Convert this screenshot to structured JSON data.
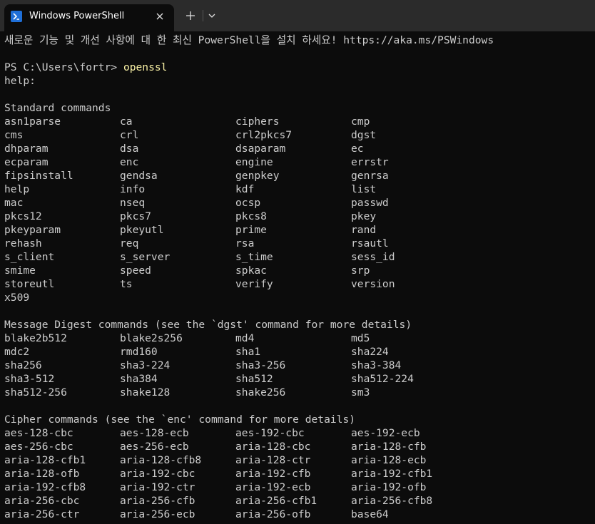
{
  "tab": {
    "title": "Windows PowerShell",
    "close_icon": "close-icon",
    "new_tab_icon": "plus-icon",
    "dropdown_icon": "chevron-down-icon"
  },
  "terminal": {
    "banner": "새로운 기능 및 개선 사항에 대 한 최신 PowerShell을 설치 하세요! https://aka.ms/PSWindows",
    "prompt": "PS C:\\Users\\fortr> ",
    "command": "openssl",
    "help_line": "help:",
    "standard_header": "Standard commands",
    "standard_commands": [
      [
        "asn1parse",
        "ca",
        "ciphers",
        "cmp"
      ],
      [
        "cms",
        "crl",
        "crl2pkcs7",
        "dgst"
      ],
      [
        "dhparam",
        "dsa",
        "dsaparam",
        "ec"
      ],
      [
        "ecparam",
        "enc",
        "engine",
        "errstr"
      ],
      [
        "fipsinstall",
        "gendsa",
        "genpkey",
        "genrsa"
      ],
      [
        "help",
        "info",
        "kdf",
        "list"
      ],
      [
        "mac",
        "nseq",
        "ocsp",
        "passwd"
      ],
      [
        "pkcs12",
        "pkcs7",
        "pkcs8",
        "pkey"
      ],
      [
        "pkeyparam",
        "pkeyutl",
        "prime",
        "rand"
      ],
      [
        "rehash",
        "req",
        "rsa",
        "rsautl"
      ],
      [
        "s_client",
        "s_server",
        "s_time",
        "sess_id"
      ],
      [
        "smime",
        "speed",
        "spkac",
        "srp"
      ],
      [
        "storeutl",
        "ts",
        "verify",
        "version"
      ],
      [
        "x509"
      ]
    ],
    "digest_header": "Message Digest commands (see the `dgst' command for more details)",
    "digest_commands": [
      [
        "blake2b512",
        "blake2s256",
        "md4",
        "md5"
      ],
      [
        "mdc2",
        "rmd160",
        "sha1",
        "sha224"
      ],
      [
        "sha256",
        "sha3-224",
        "sha3-256",
        "sha3-384"
      ],
      [
        "sha3-512",
        "sha384",
        "sha512",
        "sha512-224"
      ],
      [
        "sha512-256",
        "shake128",
        "shake256",
        "sm3"
      ]
    ],
    "cipher_header": "Cipher commands (see the `enc' command for more details)",
    "cipher_commands": [
      [
        "aes-128-cbc",
        "aes-128-ecb",
        "aes-192-cbc",
        "aes-192-ecb"
      ],
      [
        "aes-256-cbc",
        "aes-256-ecb",
        "aria-128-cbc",
        "aria-128-cfb"
      ],
      [
        "aria-128-cfb1",
        "aria-128-cfb8",
        "aria-128-ctr",
        "aria-128-ecb"
      ],
      [
        "aria-128-ofb",
        "aria-192-cbc",
        "aria-192-cfb",
        "aria-192-cfb1"
      ],
      [
        "aria-192-cfb8",
        "aria-192-ctr",
        "aria-192-ecb",
        "aria-192-ofb"
      ],
      [
        "aria-256-cbc",
        "aria-256-cfb",
        "aria-256-cfb1",
        "aria-256-cfb8"
      ],
      [
        "aria-256-ctr",
        "aria-256-ecb",
        "aria-256-ofb",
        "base64"
      ]
    ]
  }
}
